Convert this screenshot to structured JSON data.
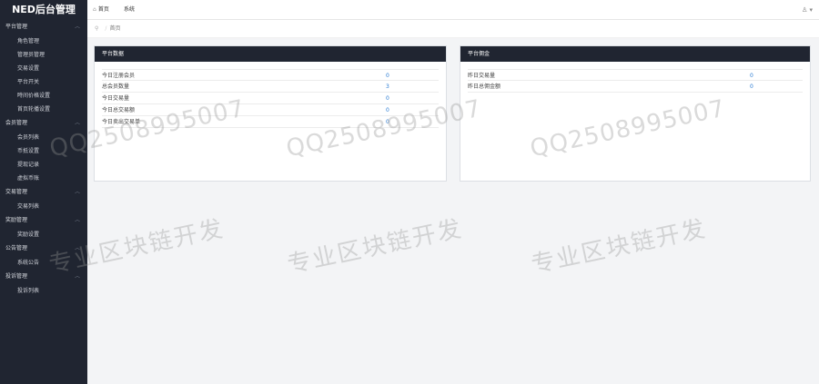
{
  "app": {
    "title": "NED后台管理"
  },
  "sidebar": {
    "groups": [
      {
        "label": "平台管理",
        "items": [
          "角色管理",
          "管理员管理",
          "交易设置",
          "平台开关",
          "時间价格设置",
          "首页轮播设置"
        ]
      },
      {
        "label": "会员管理",
        "items": [
          "会员列表",
          "币抵设置",
          "提现记录",
          "虚拟币账"
        ]
      },
      {
        "label": "交易管理",
        "items": [
          "交易列表"
        ]
      },
      {
        "label": "奖励管理",
        "items": [
          "奖励设置"
        ]
      },
      {
        "label": "公告管理",
        "items": [
          "系统公告"
        ]
      },
      {
        "label": "投诉管理",
        "items": [
          "投诉列表"
        ]
      }
    ]
  },
  "topbar": {
    "tabs": [
      {
        "label": "首页"
      },
      {
        "label": "系统"
      }
    ],
    "user_glyph": "♙ ▾"
  },
  "breadcrumb": {
    "items": [
      "首页"
    ]
  },
  "panels": {
    "platform_data": {
      "title": "平台数据",
      "rows": [
        {
          "label": "今日注册会员",
          "value": "0"
        },
        {
          "label": "总会员数量",
          "value": "3"
        },
        {
          "label": "今日交易量",
          "value": "0"
        },
        {
          "label": "今日总交易额",
          "value": "0"
        },
        {
          "label": "今日卖出交易单",
          "value": "0"
        }
      ]
    },
    "platform_fees": {
      "title": "平台佣金",
      "rows": [
        {
          "label": "昨日交易量",
          "value": "0"
        },
        {
          "label": "昨日总佣金额",
          "value": "0"
        }
      ]
    }
  },
  "watermarks": {
    "qq": "QQ2508995007",
    "cn": "专业区块链开发"
  },
  "colors": {
    "sidebar_bg": "#202531",
    "panel_header_bg": "#202531",
    "value_link": "#2b7cd3"
  },
  "icons": {
    "home": "home-icon",
    "location": "location-pin-icon",
    "user": "user-icon",
    "chevron": "chevron-down-icon"
  }
}
